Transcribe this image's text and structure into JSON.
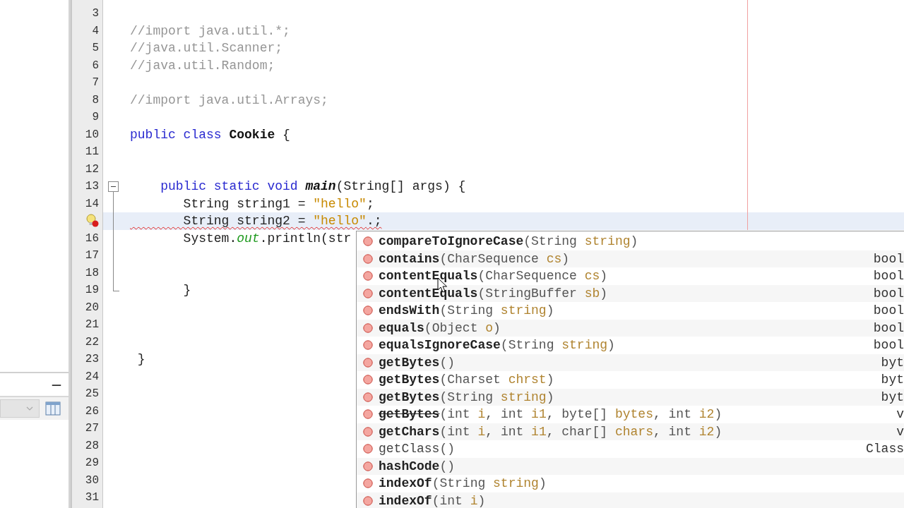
{
  "left_panel": {
    "bottom_panel": {
      "minimize": "—"
    }
  },
  "editor": {
    "lines": [
      {
        "number": "3",
        "error": false,
        "current": false
      },
      {
        "number": "4",
        "error": false,
        "current": false,
        "segments": [
          {
            "kind": "comment",
            "text": "//import java.util.*;"
          }
        ]
      },
      {
        "number": "5",
        "error": false,
        "current": false,
        "segments": [
          {
            "kind": "comment",
            "text": "//java.util.Scanner;"
          }
        ]
      },
      {
        "number": "6",
        "error": false,
        "current": false,
        "segments": [
          {
            "kind": "comment",
            "text": "//java.util.Random;"
          }
        ]
      },
      {
        "number": "7",
        "error": false,
        "current": false
      },
      {
        "number": "8",
        "error": false,
        "current": false,
        "segments": [
          {
            "kind": "comment",
            "text": "//import java.util.Arrays;"
          }
        ]
      },
      {
        "number": "9",
        "error": false,
        "current": false
      },
      {
        "number": "10",
        "error": false,
        "current": false,
        "segments": [
          {
            "kind": "keyword",
            "text": "public class "
          },
          {
            "kind": "class",
            "text": "Cookie"
          },
          {
            "kind": "plain",
            "text": " {"
          }
        ]
      },
      {
        "number": "11",
        "error": false,
        "current": false
      },
      {
        "number": "12",
        "error": false,
        "current": false
      },
      {
        "number": "13",
        "error": false,
        "current": false,
        "fold_start": true,
        "segments": [
          {
            "kind": "keyword",
            "text": "    public static void "
          },
          {
            "kind": "method",
            "text": "main"
          },
          {
            "kind": "plain",
            "text": "(String[] args) {"
          }
        ]
      },
      {
        "number": "14",
        "error": false,
        "current": false,
        "segments": [
          {
            "kind": "plain",
            "text": "       String string1 = "
          },
          {
            "kind": "string",
            "text": "\"hello\""
          },
          {
            "kind": "plain",
            "text": ";"
          }
        ]
      },
      {
        "error": true,
        "current": true,
        "segments": [
          {
            "kind": "plain",
            "text": "       String string2 = "
          },
          {
            "kind": "string",
            "text": "\"hello\""
          },
          {
            "kind": "plain",
            "text": ".;"
          }
        ]
      },
      {
        "number": "16",
        "error": false,
        "current": false,
        "segments": [
          {
            "kind": "plain",
            "text": "       System."
          },
          {
            "kind": "field",
            "text": "out"
          },
          {
            "kind": "plain",
            "text": ".println(str"
          }
        ]
      },
      {
        "number": "17",
        "error": false,
        "current": false
      },
      {
        "number": "18",
        "error": false,
        "current": false
      },
      {
        "number": "19",
        "error": false,
        "current": false,
        "fold_end": true,
        "segments": [
          {
            "kind": "plain",
            "text": "       }"
          }
        ]
      },
      {
        "number": "20",
        "error": false,
        "current": false
      },
      {
        "number": "21",
        "error": false,
        "current": false
      },
      {
        "number": "22",
        "error": false,
        "current": false
      },
      {
        "number": "23",
        "error": false,
        "current": false,
        "segments": [
          {
            "kind": "plain",
            "text": " }"
          }
        ]
      },
      {
        "number": "24",
        "error": false,
        "current": false
      },
      {
        "number": "25",
        "error": false,
        "current": false
      },
      {
        "number": "26",
        "error": false,
        "current": false
      },
      {
        "number": "27",
        "error": false,
        "current": false
      },
      {
        "number": "28",
        "error": false,
        "current": false
      },
      {
        "number": "29",
        "error": false,
        "current": false
      },
      {
        "number": "30",
        "error": false,
        "current": false
      },
      {
        "number": "31",
        "error": false,
        "current": false
      }
    ]
  },
  "completion": {
    "items": [
      {
        "inherited": false,
        "deprecated": false,
        "signature": [
          {
            "kind": "name",
            "text": "compareToIgnoreCase"
          },
          {
            "kind": "punct",
            "text": "("
          },
          {
            "kind": "type",
            "text": "String "
          },
          {
            "kind": "param",
            "text": "string"
          },
          {
            "kind": "punct",
            "text": ")"
          }
        ]
      },
      {
        "inherited": false,
        "deprecated": false,
        "signature": [
          {
            "kind": "name",
            "text": "contains"
          },
          {
            "kind": "punct",
            "text": "("
          },
          {
            "kind": "type",
            "text": "CharSequence "
          },
          {
            "kind": "param",
            "text": "cs"
          },
          {
            "kind": "punct",
            "text": ")"
          }
        ],
        "return_type": "bool"
      },
      {
        "inherited": false,
        "deprecated": false,
        "signature": [
          {
            "kind": "name",
            "text": "contentEquals"
          },
          {
            "kind": "punct",
            "text": "("
          },
          {
            "kind": "type",
            "text": "CharSequence "
          },
          {
            "kind": "param",
            "text": "cs"
          },
          {
            "kind": "punct",
            "text": ")"
          }
        ],
        "return_type": "bool"
      },
      {
        "inherited": false,
        "deprecated": false,
        "signature": [
          {
            "kind": "name",
            "text": "contentEquals"
          },
          {
            "kind": "punct",
            "text": "("
          },
          {
            "kind": "type",
            "text": "StringBuffer "
          },
          {
            "kind": "param",
            "text": "sb"
          },
          {
            "kind": "punct",
            "text": ")"
          }
        ],
        "return_type": "bool"
      },
      {
        "inherited": false,
        "deprecated": false,
        "signature": [
          {
            "kind": "name",
            "text": "endsWith"
          },
          {
            "kind": "punct",
            "text": "("
          },
          {
            "kind": "type",
            "text": "String "
          },
          {
            "kind": "param",
            "text": "string"
          },
          {
            "kind": "punct",
            "text": ")"
          }
        ],
        "return_type": "bool"
      },
      {
        "inherited": false,
        "deprecated": false,
        "signature": [
          {
            "kind": "name",
            "text": "equals"
          },
          {
            "kind": "punct",
            "text": "("
          },
          {
            "kind": "type",
            "text": "Object "
          },
          {
            "kind": "param",
            "text": "o"
          },
          {
            "kind": "punct",
            "text": ")"
          }
        ],
        "return_type": "bool"
      },
      {
        "inherited": false,
        "deprecated": false,
        "signature": [
          {
            "kind": "name",
            "text": "equalsIgnoreCase"
          },
          {
            "kind": "punct",
            "text": "("
          },
          {
            "kind": "type",
            "text": "String "
          },
          {
            "kind": "param",
            "text": "string"
          },
          {
            "kind": "punct",
            "text": ")"
          }
        ],
        "return_type": "bool"
      },
      {
        "inherited": false,
        "deprecated": false,
        "signature": [
          {
            "kind": "name",
            "text": "getBytes"
          },
          {
            "kind": "punct",
            "text": "()"
          }
        ],
        "return_type": "byt"
      },
      {
        "inherited": false,
        "deprecated": false,
        "signature": [
          {
            "kind": "name",
            "text": "getBytes"
          },
          {
            "kind": "punct",
            "text": "("
          },
          {
            "kind": "type",
            "text": "Charset "
          },
          {
            "kind": "param",
            "text": "chrst"
          },
          {
            "kind": "punct",
            "text": ")"
          }
        ],
        "return_type": "byt"
      },
      {
        "inherited": false,
        "deprecated": false,
        "signature": [
          {
            "kind": "name",
            "text": "getBytes"
          },
          {
            "kind": "punct",
            "text": "("
          },
          {
            "kind": "type",
            "text": "String "
          },
          {
            "kind": "param",
            "text": "string"
          },
          {
            "kind": "punct",
            "text": ")"
          }
        ],
        "return_type": "byt"
      },
      {
        "inherited": false,
        "deprecated": true,
        "signature": [
          {
            "kind": "name",
            "text": "getBytes"
          },
          {
            "kind": "punct",
            "text": "("
          },
          {
            "kind": "type",
            "text": "int "
          },
          {
            "kind": "param",
            "text": "i"
          },
          {
            "kind": "punct",
            "text": ", "
          },
          {
            "kind": "type",
            "text": "int "
          },
          {
            "kind": "param",
            "text": "i1"
          },
          {
            "kind": "punct",
            "text": ", "
          },
          {
            "kind": "type",
            "text": "byte[] "
          },
          {
            "kind": "param",
            "text": "bytes"
          },
          {
            "kind": "punct",
            "text": ", "
          },
          {
            "kind": "type",
            "text": "int "
          },
          {
            "kind": "param",
            "text": "i2"
          },
          {
            "kind": "punct",
            "text": ")"
          }
        ],
        "return_type": "v"
      },
      {
        "inherited": false,
        "deprecated": false,
        "signature": [
          {
            "kind": "name",
            "text": "getChars"
          },
          {
            "kind": "punct",
            "text": "("
          },
          {
            "kind": "type",
            "text": "int "
          },
          {
            "kind": "param",
            "text": "i"
          },
          {
            "kind": "punct",
            "text": ", "
          },
          {
            "kind": "type",
            "text": "int "
          },
          {
            "kind": "param",
            "text": "i1"
          },
          {
            "kind": "punct",
            "text": ", "
          },
          {
            "kind": "type",
            "text": "char[] "
          },
          {
            "kind": "param",
            "text": "chars"
          },
          {
            "kind": "punct",
            "text": ", "
          },
          {
            "kind": "type",
            "text": "int "
          },
          {
            "kind": "param",
            "text": "i2"
          },
          {
            "kind": "punct",
            "text": ")"
          }
        ],
        "return_type": "v"
      },
      {
        "inherited": true,
        "deprecated": false,
        "signature": [
          {
            "kind": "name",
            "text": "getClass"
          },
          {
            "kind": "punct",
            "text": "()"
          }
        ],
        "return_type": "Class"
      },
      {
        "inherited": false,
        "deprecated": false,
        "signature": [
          {
            "kind": "name",
            "text": "hashCode"
          },
          {
            "kind": "punct",
            "text": "()"
          }
        ]
      },
      {
        "inherited": false,
        "deprecated": false,
        "signature": [
          {
            "kind": "name",
            "text": "indexOf"
          },
          {
            "kind": "punct",
            "text": "("
          },
          {
            "kind": "type",
            "text": "String "
          },
          {
            "kind": "param",
            "text": "string"
          },
          {
            "kind": "punct",
            "text": ")"
          }
        ]
      },
      {
        "inherited": false,
        "deprecated": false,
        "signature": [
          {
            "kind": "name",
            "text": "indexOf"
          },
          {
            "kind": "punct",
            "text": "("
          },
          {
            "kind": "type",
            "text": "int "
          },
          {
            "kind": "param",
            "text": "i"
          },
          {
            "kind": "punct",
            "text": ")"
          }
        ]
      }
    ]
  }
}
